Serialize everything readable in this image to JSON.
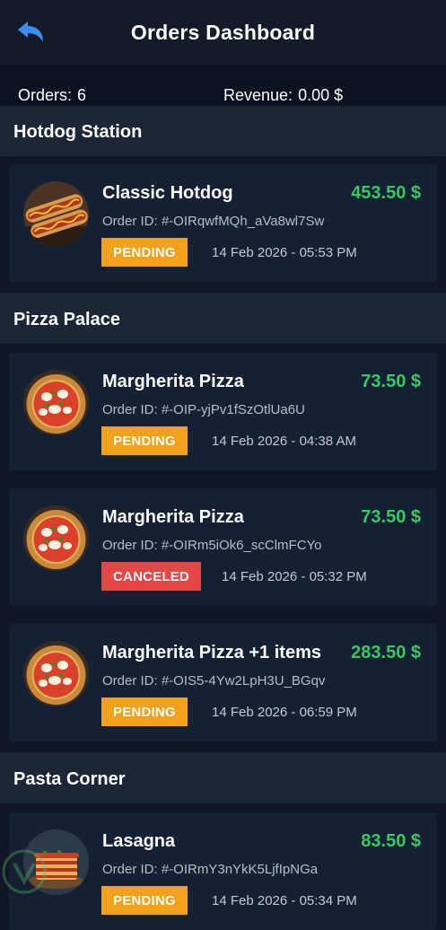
{
  "header": {
    "title": "Orders Dashboard",
    "back_icon": "back-arrow-icon"
  },
  "summary": {
    "orders_label": "Orders:",
    "orders_count": "6",
    "revenue_label": "Revenue:",
    "revenue_value": "0.00 $"
  },
  "colors": {
    "pending": "#f2a11a",
    "canceled": "#e84545",
    "price": "#36c964",
    "accent": "#3d8ef0"
  },
  "groups": [
    {
      "name": "Hotdog Station",
      "orders": [
        {
          "item": "Classic Hotdog",
          "price": "453.50 $",
          "order_id": "Order ID: #-OIRqwfMQh_aVa8wl7Sw",
          "status": "PENDING",
          "date": "14 Feb 2026 - 05:53 PM",
          "image": "hotdog-image"
        }
      ]
    },
    {
      "name": "Pizza Palace",
      "orders": [
        {
          "item": "Margherita Pizza",
          "price": "73.50 $",
          "order_id": "Order ID: #-OIP-yjPv1fSzOtlUa6U",
          "status": "PENDING",
          "date": "14 Feb 2026 - 04:38 AM",
          "image": "pizza-image"
        },
        {
          "item": "Margherita Pizza",
          "price": "73.50 $",
          "order_id": "Order ID: #-OIRm5iOk6_scClmFCYo",
          "status": "CANCELED",
          "date": "14 Feb 2026 - 05:32 PM",
          "image": "pizza-image"
        },
        {
          "item": "Margherita Pizza +1 items",
          "price": "283.50 $",
          "order_id": "Order ID: #-OIS5-4Yw2LpH3U_BGqv",
          "status": "PENDING",
          "date": "14 Feb 2026 - 06:59 PM",
          "image": "pizza-image"
        }
      ]
    },
    {
      "name": "Pasta Corner",
      "orders": [
        {
          "item": "Lasagna",
          "price": "83.50 $",
          "order_id": "Order ID: #-OIRmY3nYkK5LjfIpNGa",
          "status": "PENDING",
          "date": "14 Feb 2026 - 05:34 PM",
          "image": "lasagna-image"
        }
      ]
    }
  ]
}
